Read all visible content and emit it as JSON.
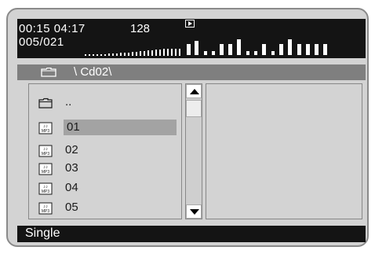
{
  "status": {
    "elapsed_time": "00:15",
    "total_time": "04:17",
    "bitrate": "128",
    "track_position": "005/021",
    "play_state_icon": "play-icon"
  },
  "path": {
    "folder_icon": "folder-icon",
    "breadcrumb": "\\ Cd02\\"
  },
  "file_list": {
    "items": [
      {
        "label": "..",
        "icon": "folder-icon",
        "selected": false
      },
      {
        "label": "01",
        "icon": "mp3-file-icon",
        "selected": true
      },
      {
        "label": "02",
        "icon": "mp3-file-icon",
        "selected": false
      },
      {
        "label": "03",
        "icon": "mp3-file-icon",
        "selected": false
      },
      {
        "label": "04",
        "icon": "mp3-file-icon",
        "selected": false
      },
      {
        "label": "05",
        "icon": "mp3-file-icon",
        "selected": false
      }
    ]
  },
  "mode": {
    "label": "Single"
  },
  "colors": {
    "background": "#d3d3d3",
    "bar": "#141414",
    "path_bar": "#7f7f7f",
    "selection": "#a3a3a3"
  }
}
